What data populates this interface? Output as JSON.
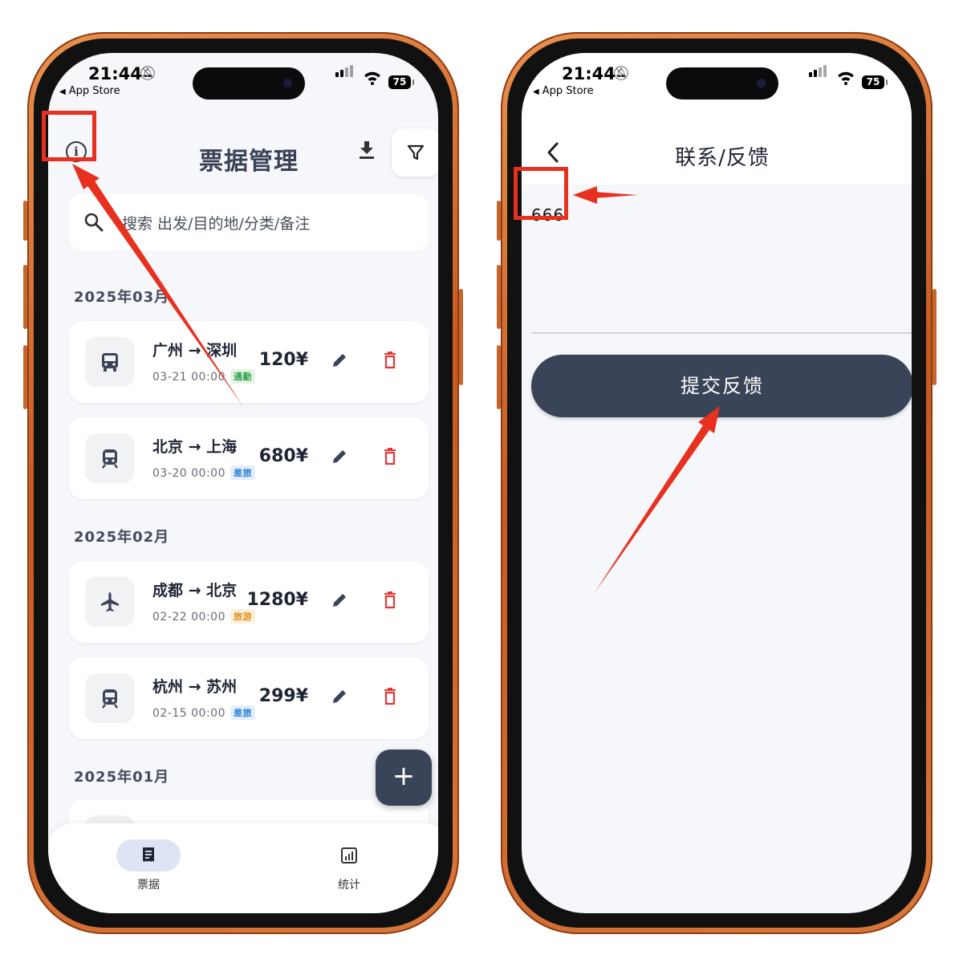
{
  "statusbar": {
    "time": "21:44",
    "back_app": "App Store",
    "battery": "75"
  },
  "left_screen": {
    "header": {
      "title": "票据管理"
    },
    "search": {
      "placeholder": "搜索 出发/目的地/分类/备注"
    },
    "months": [
      {
        "label": "2025年03月",
        "tickets": [
          {
            "route": "广州 → 深圳",
            "datetime": "03-21 00:00",
            "tag": "通勤",
            "tag_color": "#2e9e44",
            "tag_bg": "#e4f5e7",
            "price": "120¥",
            "transport_icon": "bus-icon"
          },
          {
            "route": "北京 → 上海",
            "datetime": "03-20 00:00",
            "tag": "差旅",
            "tag_color": "#2b7fd8",
            "tag_bg": "#e3effc",
            "price": "680¥",
            "transport_icon": "train-icon"
          }
        ]
      },
      {
        "label": "2025年02月",
        "tickets": [
          {
            "route": "成都 → 北京",
            "datetime": "02-22 00:00",
            "tag": "旅游",
            "tag_color": "#e0921a",
            "tag_bg": "#fdf1dc",
            "price": "1280¥",
            "transport_icon": "airplane-icon"
          },
          {
            "route": "杭州 → 苏州",
            "datetime": "02-15 00:00",
            "tag": "差旅",
            "tag_color": "#2b7fd8",
            "tag_bg": "#e3effc",
            "price": "299¥",
            "transport_icon": "train-icon"
          }
        ]
      },
      {
        "label": "2025年01月",
        "tickets": []
      }
    ],
    "fab": "+",
    "tabs": [
      {
        "label": "票据",
        "icon": "receipt-icon",
        "active": true
      },
      {
        "label": "统计",
        "icon": "chart-icon",
        "active": false
      }
    ]
  },
  "right_screen": {
    "title": "联系/反馈",
    "input_value": "666",
    "submit_label": "提交反馈"
  },
  "colors": {
    "primary": "#3a4458",
    "danger": "#e53935",
    "annotation": "#e8301f",
    "phone_frame": "#d46a2e",
    "background": "#f6f7fa"
  }
}
